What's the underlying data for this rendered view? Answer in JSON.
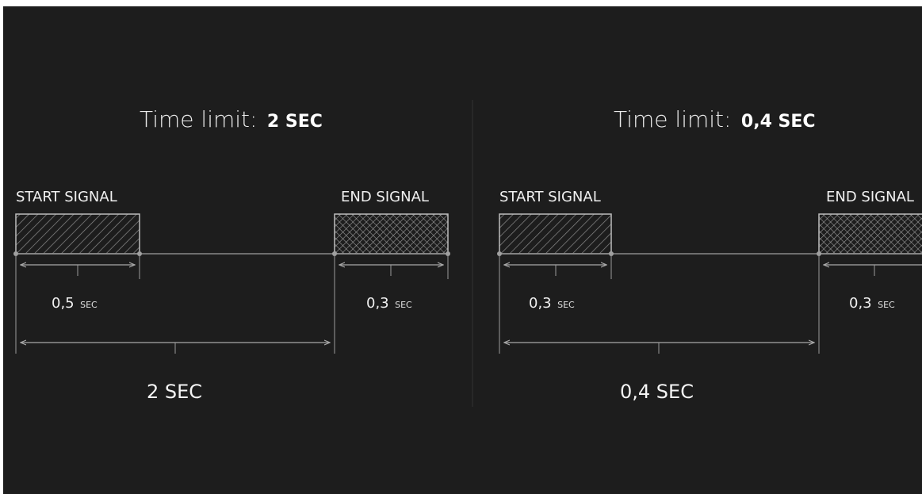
{
  "panels": [
    {
      "title_prefix": "Time limit:",
      "title_value": "2 SEC",
      "start_label": "START SIGNAL",
      "end_label": "END SIGNAL",
      "start_duration_num": "0,5",
      "start_duration_unit": "SEC",
      "end_duration_num": "0,3",
      "end_duration_unit": "SEC",
      "total_label": "2 SEC"
    },
    {
      "title_prefix": "Time limit:",
      "title_value": "0,4 SEC",
      "start_label": "START SIGNAL",
      "end_label": "END SIGNAL",
      "start_duration_num": "0,3",
      "start_duration_unit": "SEC",
      "end_duration_num": "0,3",
      "end_duration_unit": "SEC",
      "total_label": "0,4 SEC"
    }
  ],
  "colors": {
    "background": "#1d1d1d",
    "text": "#f0f0f0",
    "lines": "#8a8a8a"
  }
}
